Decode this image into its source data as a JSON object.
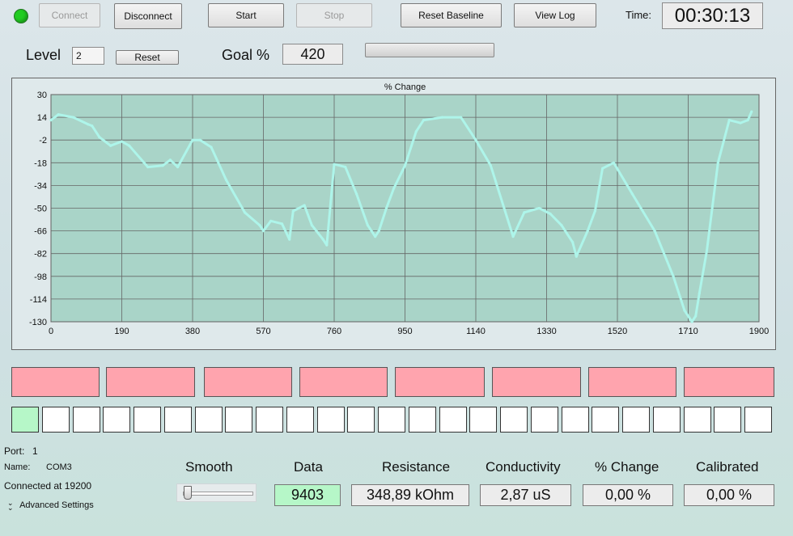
{
  "toolbar": {
    "connect_label": "Connect",
    "disconnect_label": "Disconnect",
    "start_label": "Start",
    "stop_label": "Stop",
    "reset_baseline_label": "Reset Baseline",
    "view_log_label": "View Log",
    "time_label": "Time:",
    "time_value": "00:30:13",
    "status_color": "#22cc22"
  },
  "level": {
    "label": "Level",
    "value": "2",
    "reset_label": "Reset",
    "goal_label": "Goal %",
    "goal_value": "420",
    "progress": 0
  },
  "chart_data": {
    "type": "line",
    "title": "% Change",
    "xlabel": "",
    "ylabel": "",
    "xlim": [
      0,
      1900
    ],
    "ylim": [
      -130,
      30
    ],
    "x_ticks": [
      "0",
      "190",
      "380",
      "570",
      "760",
      "950",
      "1140",
      "1330",
      "1520",
      "1710",
      "1900"
    ],
    "y_ticks": [
      "30",
      "14",
      "-2",
      "-18",
      "-34",
      "-50",
      "-66",
      "-82",
      "-98",
      "-114",
      "-130"
    ],
    "grid": true,
    "colors": {
      "line": "#aef5ea",
      "plot_bg": "#a9d4c8",
      "frame": "#555555"
    },
    "series": [
      {
        "x": [
          0,
          20,
          60,
          100,
          110,
          130,
          160,
          190,
          210,
          250,
          260,
          300,
          320,
          340,
          380,
          400,
          430,
          470,
          520,
          560,
          570,
          590,
          620,
          640,
          650,
          680,
          700,
          730,
          740,
          760,
          790,
          820,
          850,
          870,
          880,
          900,
          920,
          950,
          980,
          1000,
          1050,
          1100,
          1140,
          1180,
          1240,
          1270,
          1310,
          1340,
          1370,
          1400,
          1410,
          1440,
          1460,
          1480,
          1510,
          1560,
          1620,
          1670,
          1700,
          1720,
          1730,
          1740,
          1760,
          1790,
          1820,
          1850,
          1870,
          1880
        ],
        "values": [
          12,
          16,
          14,
          9,
          8,
          0,
          -6,
          -3,
          -6,
          -18,
          -21,
          -20,
          -16,
          -21,
          -2,
          -2,
          -7,
          -30,
          -53,
          -62,
          -66,
          -59,
          -61,
          -72,
          -52,
          -48,
          -62,
          -72,
          -76,
          -19,
          -21,
          -40,
          -62,
          -70,
          -66,
          -50,
          -36,
          -20,
          4,
          12,
          14,
          14,
          -2,
          -20,
          -70,
          -53,
          -50,
          -54,
          -62,
          -74,
          -84,
          -66,
          -52,
          -22,
          -18,
          -40,
          -66,
          -98,
          -122,
          -130,
          -126,
          -110,
          -80,
          -18,
          12,
          10,
          12,
          18
        ]
      }
    ]
  },
  "pink_indicators": [
    "",
    "",
    "",
    "",
    "",
    "",
    "",
    ""
  ],
  "squares": [
    true,
    false,
    false,
    false,
    false,
    false,
    false,
    false,
    false,
    false,
    false,
    false,
    false,
    false,
    false,
    false,
    false,
    false,
    false,
    false,
    false,
    false,
    false,
    false,
    false
  ],
  "port": {
    "port_label": "Port:",
    "port_value": "1",
    "name_label": "Name:",
    "name_value": "COM3",
    "connected_text": "Connected at 19200",
    "advanced_label": "Advanced Settings"
  },
  "readouts": {
    "smooth_label": "Smooth",
    "smooth_value": 0,
    "data_label": "Data",
    "data_value": "9403",
    "data_color": "#b6f7c8",
    "resistance_label": "Resistance",
    "resistance_value": "348,89 kOhm",
    "conductivity_label": "Conductivity",
    "conductivity_value": "2,87 uS",
    "pct_change_label": "% Change",
    "pct_change_value": "0,00 %",
    "calibrated_label": "Calibrated",
    "calibrated_value": "0,00 %"
  }
}
